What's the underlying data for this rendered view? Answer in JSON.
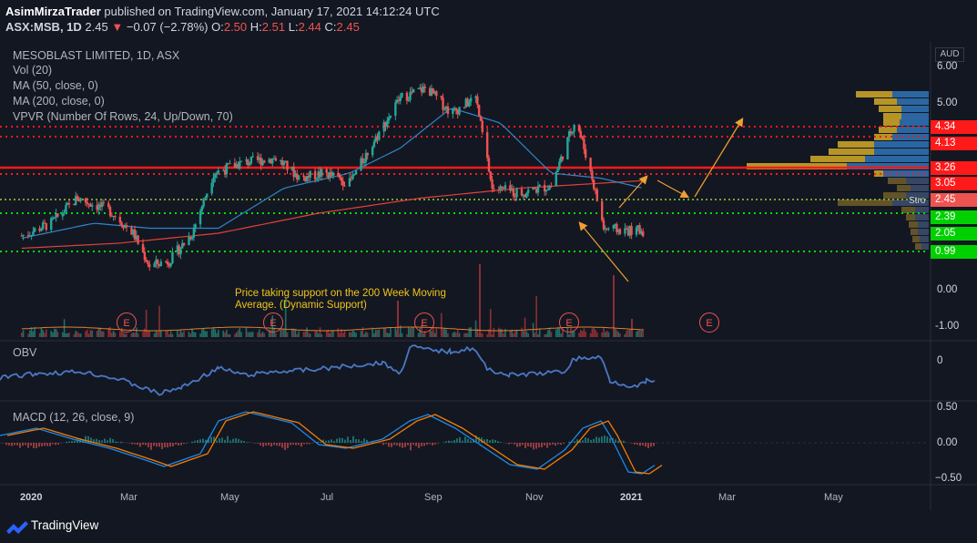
{
  "header": {
    "publisher": "AsimMirzaTrader",
    "published_text": "published on TradingView.com, January 17, 2021 14:12:24 UTC",
    "symbol": "ASX:MSB, 1D",
    "last": "2.45",
    "change": "−0.07 (−2.78%)",
    "o_label": "O:",
    "o_value": "2.50",
    "h_label": "H:",
    "h_value": "2.51",
    "l_label": "L:",
    "l_value": "2.44",
    "c_label": "C:",
    "c_value": "2.45"
  },
  "legend": {
    "title": "MESOBLAST LIMITED, 1D, ASX",
    "vol": "Vol (20)",
    "ma50": "MA (50, close, 0)",
    "ma200": "MA (200, close, 0)",
    "vpvr": "VPVR (Number Of Rows, 24, Up/Down, 70)"
  },
  "currency": "AUD",
  "annotation": "Price taking support on the 200 Week Moving Average. (Dynamic Support)",
  "strong_label": "Stro",
  "obv_title": "OBV",
  "macd_title": "MACD (12, 26, close, 9)",
  "branding": "TradingView",
  "colors": {
    "background": "#131722",
    "up": "#26a69a",
    "down": "#ef5350",
    "ma50": "#2f86c9",
    "ma200": "#e0413a",
    "obv": "#4a78c2",
    "macd": "#1e88e5",
    "signal": "#f57c00",
    "support_green": "#00e000",
    "resistance_red": "#ff1a1a",
    "arrow": "#f0a030",
    "annotation": "#f0c419"
  },
  "price_axis": {
    "ticks": [
      "6.00",
      "5.00",
      "0.00",
      "-1.00"
    ]
  },
  "price_levels": [
    {
      "value": "4.34",
      "kind": "resistance"
    },
    {
      "value": "4.13",
      "kind": "resistance"
    },
    {
      "value": "3.26",
      "kind": "resistance"
    },
    {
      "value": "3.05",
      "kind": "resistance"
    },
    {
      "value": "2.45",
      "kind": "current"
    },
    {
      "value": "2.39",
      "kind": "support"
    },
    {
      "value": "2.05",
      "kind": "support"
    },
    {
      "value": "0.99",
      "kind": "support"
    }
  ],
  "obv_axis": {
    "ticks": [
      "0"
    ]
  },
  "macd_axis": {
    "ticks": [
      "0.50",
      "0.00",
      "−0.50"
    ]
  },
  "time_axis": {
    "labels": [
      {
        "text": "2020",
        "bold": true
      },
      {
        "text": "Mar",
        "bold": false
      },
      {
        "text": "May",
        "bold": false
      },
      {
        "text": "Jul",
        "bold": false
      },
      {
        "text": "Sep",
        "bold": false
      },
      {
        "text": "Nov",
        "bold": false
      },
      {
        "text": "2021",
        "bold": true
      },
      {
        "text": "Mar",
        "bold": false
      },
      {
        "text": "May",
        "bold": false
      }
    ]
  },
  "earnings_marker": "E",
  "chart_data": {
    "type": "candlestick",
    "title": "MESOBLAST LIMITED, 1D, ASX",
    "ylim": [
      0.99,
      6.0
    ],
    "price_path": [
      [
        "2020-01-02",
        2.35
      ],
      [
        "2020-01-20",
        2.6
      ],
      [
        "2020-02-05",
        3.1
      ],
      [
        "2020-02-25",
        2.85
      ],
      [
        "2020-03-10",
        2.4
      ],
      [
        "2020-03-20",
        1.75
      ],
      [
        "2020-04-01",
        1.85
      ],
      [
        "2020-04-15",
        2.4
      ],
      [
        "2020-04-28",
        3.6
      ],
      [
        "2020-05-15",
        3.8
      ],
      [
        "2020-06-05",
        3.9
      ],
      [
        "2020-06-20",
        3.5
      ],
      [
        "2020-07-05",
        3.6
      ],
      [
        "2020-07-20",
        3.4
      ],
      [
        "2020-08-05",
        4.3
      ],
      [
        "2020-08-20",
        5.1
      ],
      [
        "2020-09-05",
        5.3
      ],
      [
        "2020-09-20",
        4.8
      ],
      [
        "2020-10-05",
        5.1
      ],
      [
        "2020-10-15",
        3.3
      ],
      [
        "2020-11-01",
        3.2
      ],
      [
        "2020-11-20",
        3.35
      ],
      [
        "2020-12-05",
        4.7
      ],
      [
        "2020-12-15",
        3.5
      ],
      [
        "2020-12-22",
        2.5
      ],
      [
        "2021-01-05",
        2.45
      ],
      [
        "2021-01-15",
        2.45
      ]
    ],
    "series": [
      {
        "name": "MA (50, close, 0)",
        "values_path": [
          [
            "2020-01-02",
            2.3
          ],
          [
            "2020-02-15",
            2.6
          ],
          [
            "2020-03-20",
            2.5
          ],
          [
            "2020-05-01",
            2.5
          ],
          [
            "2020-06-10",
            3.3
          ],
          [
            "2020-07-20",
            3.6
          ],
          [
            "2020-08-20",
            4.1
          ],
          [
            "2020-09-20",
            4.9
          ],
          [
            "2020-10-20",
            4.6
          ],
          [
            "2020-11-20",
            3.6
          ],
          [
            "2020-12-20",
            3.5
          ],
          [
            "2021-01-15",
            3.3
          ]
        ]
      },
      {
        "name": "MA (200, close, 0)",
        "values_path": [
          [
            "2020-01-02",
            2.1
          ],
          [
            "2020-03-01",
            2.2
          ],
          [
            "2020-05-01",
            2.4
          ],
          [
            "2020-07-01",
            2.8
          ],
          [
            "2020-09-01",
            3.1
          ],
          [
            "2020-11-01",
            3.3
          ],
          [
            "2021-01-15",
            3.45
          ]
        ]
      }
    ],
    "ylabel": "",
    "xlabel": ""
  }
}
